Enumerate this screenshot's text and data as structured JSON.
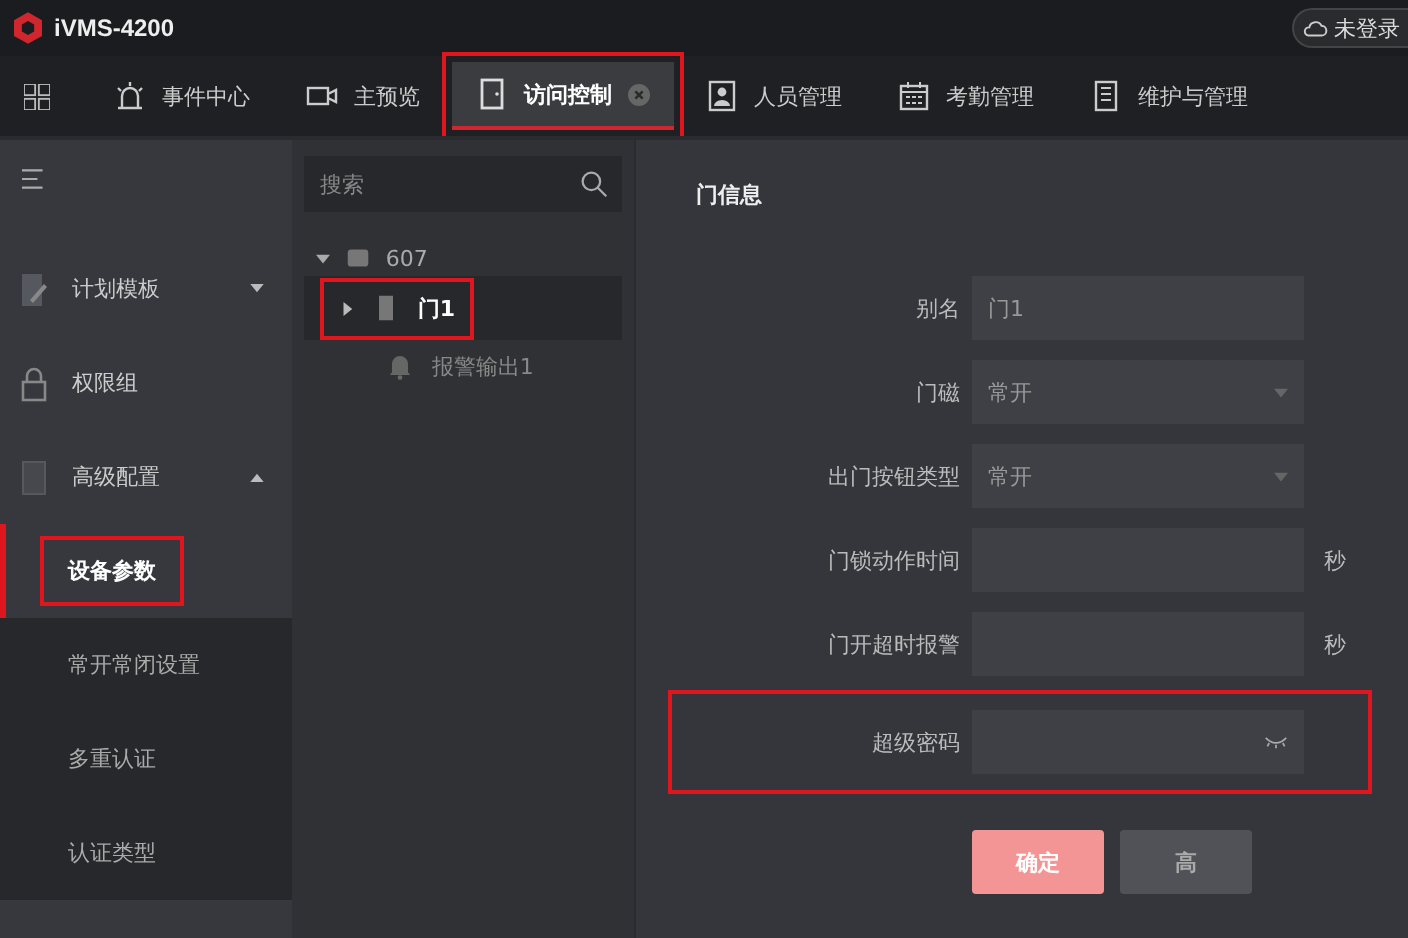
{
  "app": {
    "title": "iVMS-4200",
    "user": "未登录"
  },
  "tabs": [
    {
      "label": "事件中心",
      "selected": false,
      "highlighted": false,
      "closable": false
    },
    {
      "label": "主预览",
      "selected": false,
      "highlighted": false,
      "closable": false
    },
    {
      "label": "访问控制",
      "selected": true,
      "highlighted": true,
      "closable": true
    },
    {
      "label": "人员管理",
      "selected": false,
      "highlighted": false,
      "closable": false
    },
    {
      "label": "考勤管理",
      "selected": false,
      "highlighted": false,
      "closable": false
    },
    {
      "label": "维护与管理",
      "selected": false,
      "highlighted": false,
      "closable": false
    }
  ],
  "sidebar": {
    "items": [
      {
        "label": "计划模板",
        "expanded": false
      },
      {
        "label": "权限组"
      },
      {
        "label": "高级配置",
        "expanded": true,
        "children": [
          {
            "label": "设备参数",
            "selected": true,
            "highlighted": true
          },
          {
            "label": "常开常闭设置",
            "selected": false,
            "highlighted": false
          },
          {
            "label": "多重认证",
            "selected": false,
            "highlighted": false
          },
          {
            "label": "认证类型",
            "selected": false,
            "highlighted": false
          }
        ]
      }
    ]
  },
  "tree": {
    "search": {
      "placeholder": "搜索"
    },
    "nodes": [
      {
        "label": "607",
        "kind": "device",
        "expanded": true,
        "children": [
          {
            "label": "门1",
            "kind": "door",
            "expanded": false,
            "selected": true,
            "highlighted": true
          },
          {
            "label": "报警输出1",
            "kind": "alarm",
            "selected": false,
            "highlighted": false
          }
        ]
      }
    ]
  },
  "form": {
    "title": "门信息",
    "rows": [
      {
        "label": "别名",
        "kind": "text",
        "value": "门1",
        "highlighted": false
      },
      {
        "label": "门磁",
        "kind": "select",
        "value": "常开",
        "highlighted": false
      },
      {
        "label": "出门按钮类型",
        "kind": "select",
        "value": "常开",
        "highlighted": false
      },
      {
        "label": "门锁动作时间",
        "kind": "text",
        "unit": "秒",
        "highlighted": false
      },
      {
        "label": "门开超时报警",
        "kind": "text",
        "unit": "秒",
        "highlighted": false
      },
      {
        "label": "超级密码",
        "kind": "password",
        "highlighted": true
      }
    ],
    "buttons": [
      {
        "label": "确定",
        "kind": "primary"
      },
      {
        "label": "高",
        "kind": "secondary"
      }
    ]
  }
}
